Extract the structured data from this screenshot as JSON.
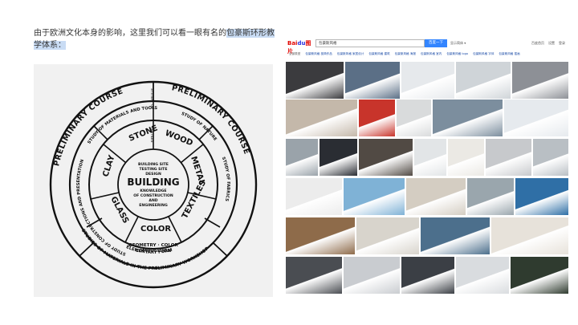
{
  "caption": {
    "prefix": "由于欧洲文化本身的影响，这里我们可以看一眼有名的",
    "highlight": "包豪斯环形教学体系："
  },
  "wheel": {
    "outer_left": "PRELIMINARY COURSE",
    "outer_right": "PRELIMINARY COURSE",
    "outer_bottom": "STUDIES OF MATERIALS IN THE PRELIMINARY WORKSHOP",
    "ring_nw": "STUDY OF MATERIALS AND TOOLS",
    "ring_ne": "STUDY OF NATURE",
    "ring_w": "STUDY OF CONSTRUCTIONS AND PRESENTATION",
    "ring_e": "STUDY OF FABRICS",
    "ring_s1": "ELEMENTARY FORM",
    "ring_top_a": "SYSTEM",
    "ring_top_b": "OF",
    "ring_top_c": "TEXTILES",
    "sectors": [
      "STONE",
      "WOOD",
      "METAL",
      "TEXTILES",
      "COLOR",
      "GLASS",
      "CLAY"
    ],
    "inner_bottom_1": "GEOMETRY · COLOR",
    "inner_bottom_2": "COMPOSITION",
    "center_small_1": "BUILDING SITE",
    "center_small_2": "TESTING SITE",
    "center_small_3": "DESIGN",
    "center_big": "BUILDING",
    "center_small_4": "KNOWLEDGE",
    "center_small_5": "OF CONSTRUCTION",
    "center_small_6": "AND",
    "center_small_7": "ENGINEERING"
  },
  "search": {
    "logo_text": "Bai",
    "logo_paw": "du",
    "logo_suffix": "图片",
    "query": "包豪斯风格",
    "button_label": "百度一下",
    "lite_toggle": "显示简体 ▾",
    "top_links": [
      "百度首页",
      "设置",
      "登录"
    ],
    "filters": [
      "全部类型",
      "包豪斯风格 极简作品",
      "包豪斯风格 家居设计",
      "包豪斯风格 建筑",
      "包豪斯风格 海报",
      "包豪斯风格 室内",
      "包豪斯风格 logo",
      "包豪斯风格 字体",
      "包豪斯风格 插画"
    ]
  },
  "colors": {
    "thumbs": [
      [
        "#3b3b3e",
        "#5b6f86",
        "#e6e9ec",
        "#cfd4d8",
        "#8d9096"
      ],
      [
        "#c4b8aa",
        "#c8342b",
        "#d9dbdc",
        "#7c8e9e",
        "#e6eaee"
      ],
      [
        "#9aa3aa",
        "#2a2d33",
        "#514a44",
        "#e2e5e7",
        "#ebe9e4",
        "#c7c9cc",
        "#b9bfc4"
      ],
      [
        "#ececec",
        "#7fb2d6",
        "#d4cdc2",
        "#9aa6ad",
        "#2f6fa6"
      ],
      [
        "#8e6b4a",
        "#d8d4cc",
        "#4c6f8c",
        "#e7e2da"
      ],
      [
        "#4a4d52",
        "#c9ccd0",
        "#3b3f45",
        "#d9dcdf",
        "#2f3b2f"
      ]
    ]
  }
}
